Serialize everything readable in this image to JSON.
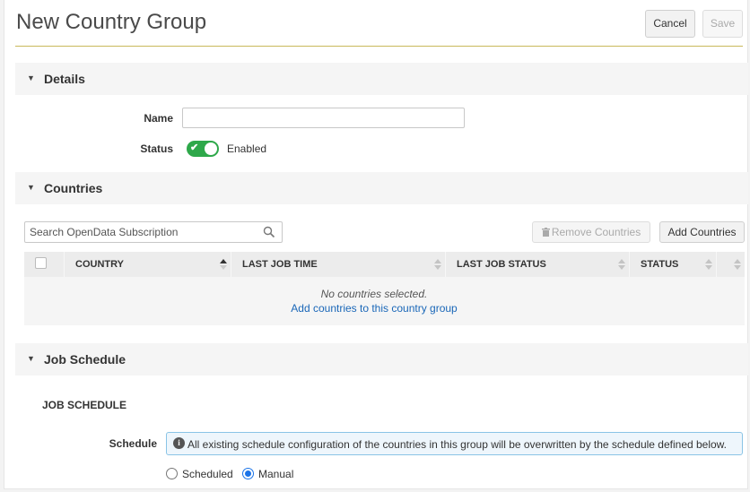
{
  "header": {
    "title": "New Country Group",
    "cancel_label": "Cancel",
    "save_label": "Save"
  },
  "details": {
    "section_label": "Details",
    "name_label": "Name",
    "name_value": "",
    "status_label": "Status",
    "status_enabled": true,
    "status_text": "Enabled"
  },
  "countries": {
    "section_label": "Countries",
    "search_placeholder": "Search OpenData Subscription",
    "remove_label": "Remove Countries",
    "add_label": "Add Countries",
    "columns": [
      "COUNTRY",
      "LAST JOB TIME",
      "LAST JOB STATUS",
      "STATUS"
    ],
    "empty_message": "No countries selected.",
    "empty_link": "Add countries to this country group"
  },
  "job_schedule": {
    "section_label": "Job Schedule",
    "sub_heading": "JOB SCHEDULE",
    "schedule_label": "Schedule",
    "info_message": "All existing schedule configuration of the countries in this group will be overwritten by the schedule defined below.",
    "options": [
      {
        "label": "Scheduled",
        "checked": false
      },
      {
        "label": "Manual",
        "checked": true
      }
    ]
  },
  "colors": {
    "accent_line": "#c9b85a",
    "toggle_on": "#2ea84a",
    "link": "#1a67b8",
    "radio_selected": "#1a73e8"
  },
  "icons": [
    "chevron-down-icon",
    "check-icon",
    "search-icon",
    "trash-icon",
    "sort-icon",
    "info-icon"
  ]
}
